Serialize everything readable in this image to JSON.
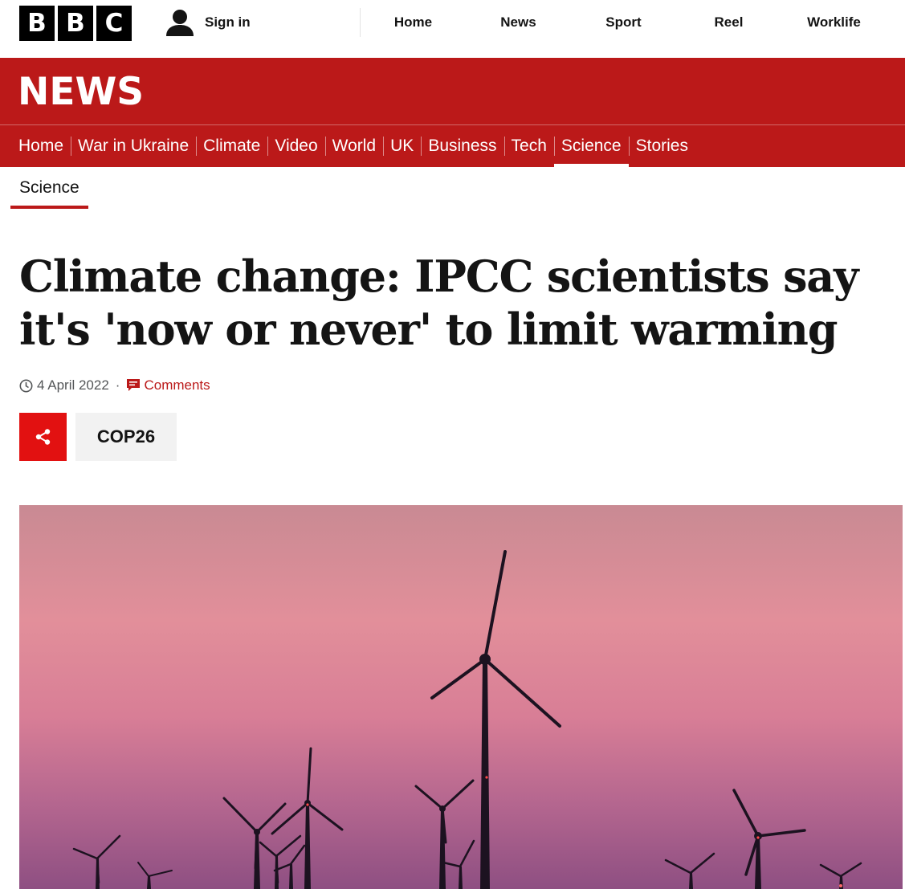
{
  "topbar": {
    "logo_letters": [
      "B",
      "B",
      "C"
    ],
    "signin_label": "Sign in",
    "signin_icon": "user-icon",
    "nav": [
      "Home",
      "News",
      "Sport",
      "Reel",
      "Worklife"
    ]
  },
  "news": {
    "logo": "NEWS",
    "sections": [
      "Home",
      "War in Ukraine",
      "Climate",
      "Video",
      "World",
      "UK",
      "Business",
      "Tech",
      "Science",
      "Stories"
    ],
    "active_section": "Science",
    "secondary": "Science"
  },
  "article": {
    "headline": "Climate change: IPCC scientists say it's 'now or never' to limit warming",
    "date": "4 April 2022",
    "separator": "·",
    "comments_label": "Comments",
    "date_icon": "clock-icon",
    "comments_icon": "comment-icon",
    "share_icon": "share-icon",
    "tag": "COP26"
  },
  "colors": {
    "brand_red": "#bb1919",
    "share_red": "#e21111",
    "text": "#141414",
    "meta_grey": "#545658",
    "tag_bg": "#f2f2f2"
  }
}
